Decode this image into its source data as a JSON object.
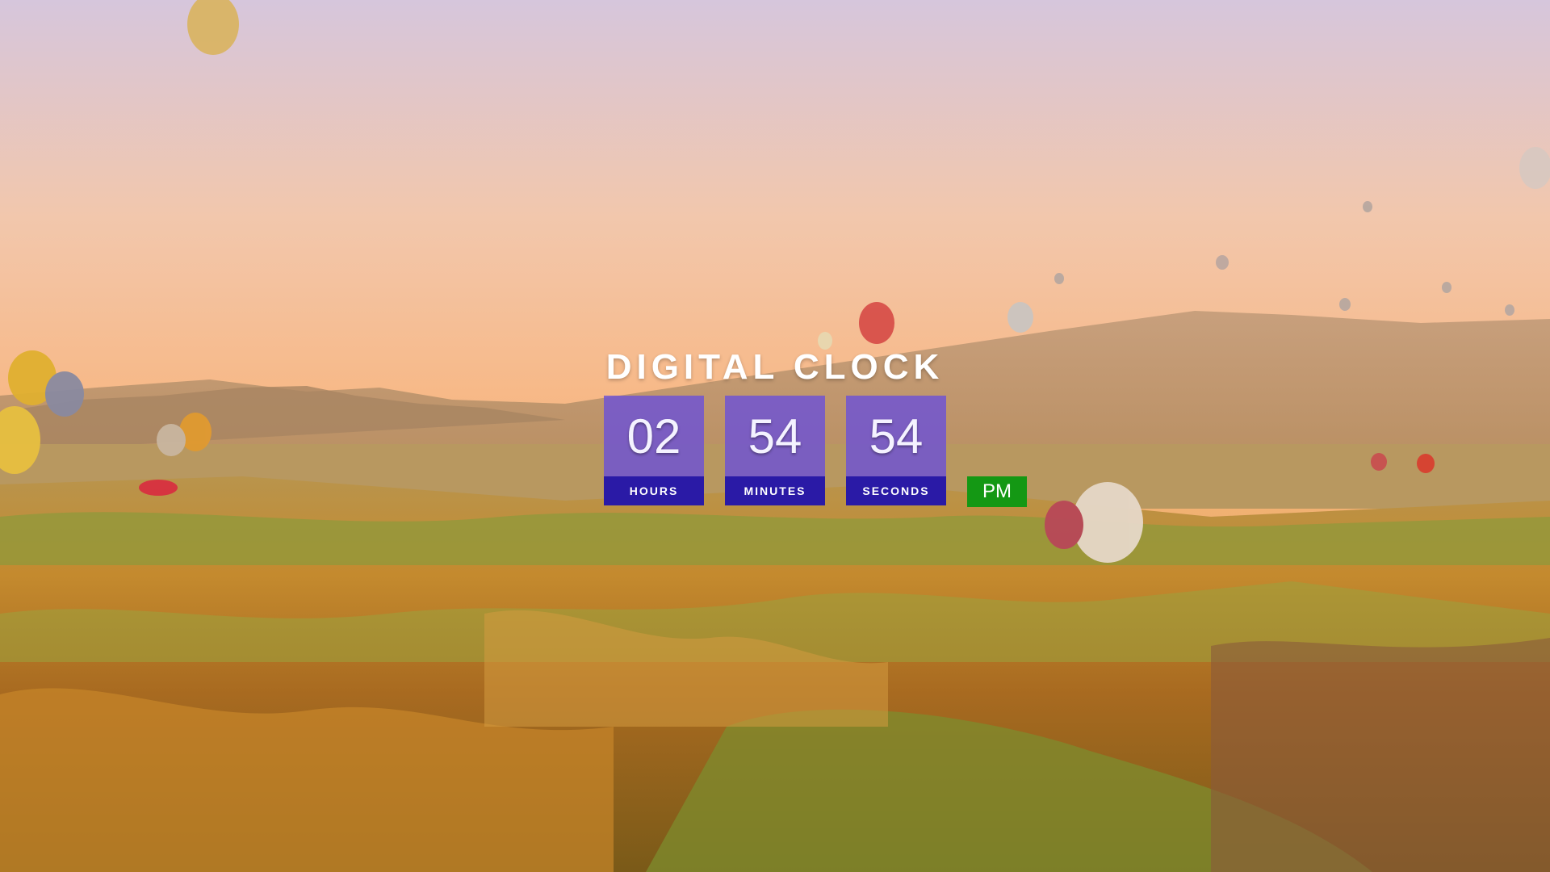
{
  "title": "DIGITAL CLOCK",
  "clock": {
    "hours": "02",
    "minutes": "54",
    "seconds": "54",
    "hours_label": "HOURS",
    "minutes_label": "MINUTES",
    "seconds_label": "SECONDS",
    "period": "PM"
  },
  "colors": {
    "digit_box": "#6c52d6",
    "label_box": "#2a1aa6",
    "period_box": "#149814",
    "text": "#ffffff"
  },
  "background": {
    "scene": "hot-air-balloons-over-valley"
  }
}
